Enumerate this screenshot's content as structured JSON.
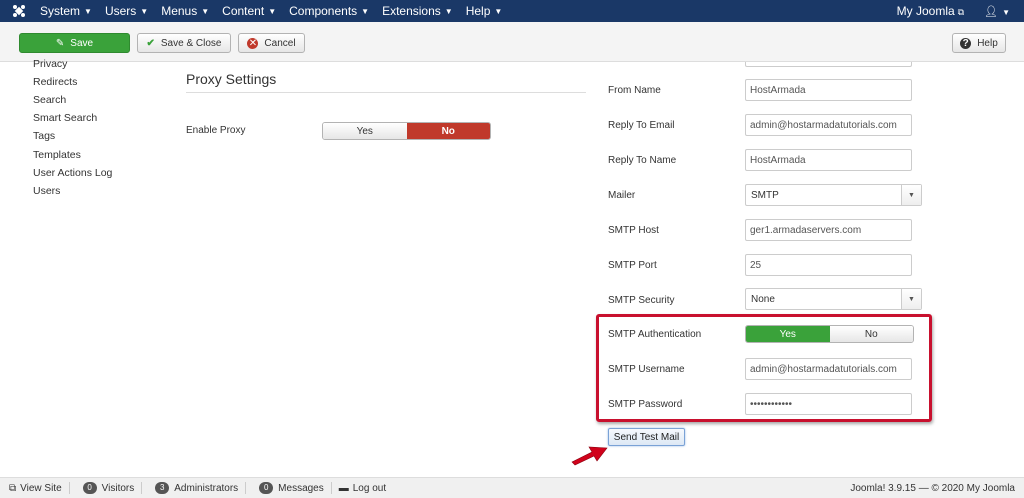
{
  "topnav": {
    "menu": [
      {
        "label": "System"
      },
      {
        "label": "Users"
      },
      {
        "label": "Menus"
      },
      {
        "label": "Content"
      },
      {
        "label": "Components"
      },
      {
        "label": "Extensions"
      },
      {
        "label": "Help"
      }
    ],
    "site_link": "My Joomla",
    "logo_icon": "joomla-logo-icon",
    "user_icon": "user-icon"
  },
  "toolbar": {
    "save_label": "Save",
    "save_close_label": "Save & Close",
    "cancel_label": "Cancel",
    "help_label": "Help"
  },
  "sidebar": {
    "items": [
      {
        "label": "Privacy"
      },
      {
        "label": "Redirects"
      },
      {
        "label": "Search"
      },
      {
        "label": "Smart Search"
      },
      {
        "label": "Tags"
      },
      {
        "label": "Templates"
      },
      {
        "label": "User Actions Log"
      },
      {
        "label": "Users"
      }
    ]
  },
  "proxy": {
    "title": "Proxy Settings",
    "enable_label": "Enable Proxy",
    "yes_label": "Yes",
    "no_label": "No",
    "selected": "No"
  },
  "mail": {
    "from_name_label": "From Name",
    "from_name_value": "HostArmada",
    "reply_email_label": "Reply To Email",
    "reply_email_value": "admin@hostarmadatutorials.com",
    "reply_name_label": "Reply To Name",
    "reply_name_value": "HostArmada",
    "mailer_label": "Mailer",
    "mailer_value": "SMTP",
    "smtp_host_label": "SMTP Host",
    "smtp_host_value": "ger1.armadaservers.com",
    "smtp_port_label": "SMTP Port",
    "smtp_port_value": "25",
    "smtp_security_label": "SMTP Security",
    "smtp_security_value": "None",
    "smtp_auth_label": "SMTP Authentication",
    "smtp_auth_yes": "Yes",
    "smtp_auth_no": "No",
    "smtp_auth_selected": "Yes",
    "smtp_username_label": "SMTP Username",
    "smtp_username_value": "admin@hostarmadatutorials.com",
    "smtp_password_label": "SMTP Password",
    "smtp_password_value": "••••••••••••",
    "test_mail_label": "Send Test Mail"
  },
  "statusbar": {
    "view_site": "View Site",
    "visitors_count": "0",
    "visitors_label": "Visitors",
    "admins_count": "3",
    "admins_label": "Administrators",
    "messages_count": "0",
    "messages_label": "Messages",
    "logout_label": "Log out",
    "version_text": "Joomla! 3.9.15 — © 2020 My Joomla"
  },
  "colors": {
    "nav_bg": "#1a3867",
    "save_green": "#3aa23a",
    "toggle_red": "#c0392b",
    "highlight_red": "#c8102e"
  }
}
